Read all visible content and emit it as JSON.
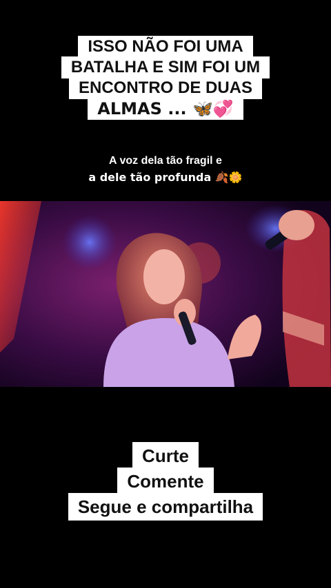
{
  "caption": {
    "lines": [
      "ISSO NÃO FOI UMA",
      "BATALHA E SIM FOI UM",
      "ENCONTRO DE DUAS",
      "ALMAS ... 🦋💞"
    ]
  },
  "subtitle": {
    "line1": "A voz dela tão fragil e",
    "line2": "a dele tão profunda 🍂🌼"
  },
  "cta": {
    "lines": [
      "Curte",
      "Comente",
      "Segue e compartilha"
    ]
  },
  "colors": {
    "background": "#000000",
    "caption_bg": "#ffffff",
    "caption_text": "#111111",
    "subtitle_text": "#ffffff"
  }
}
